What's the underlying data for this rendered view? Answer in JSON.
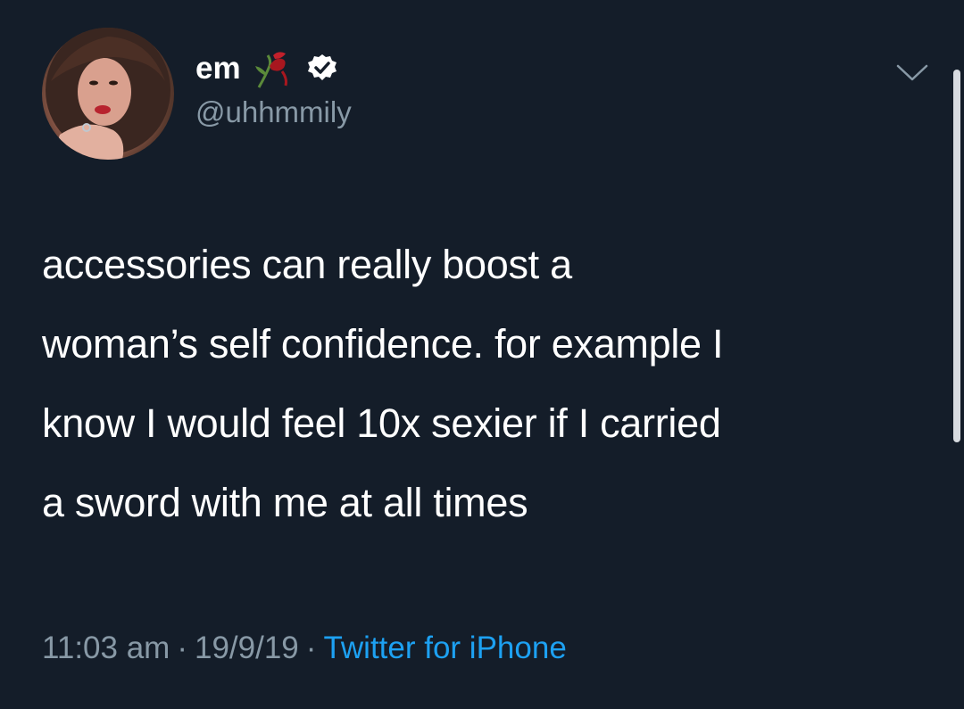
{
  "tweet": {
    "author": {
      "display_name": "em",
      "emoji_icon": "wilted-rose-icon",
      "verified_icon": "verified-badge-icon",
      "handle": "@uhhmmily",
      "avatar_icon": "avatar"
    },
    "menu_icon": "chevron-down-icon",
    "text_lines": [
      "accessories can really boost a",
      "woman’s self confidence. for example I",
      "know I would feel 10x sexier if I carried",
      "a sword with me at all times"
    ],
    "meta": {
      "time": "11:03 am",
      "separator": "·",
      "date": "19/9/19",
      "source": "Twitter for iPhone"
    }
  },
  "colors": {
    "background": "#141d29",
    "text": "#ffffff",
    "secondary_text": "#8899a6",
    "link": "#1da1f2",
    "verified_badge": "#ffffff"
  }
}
